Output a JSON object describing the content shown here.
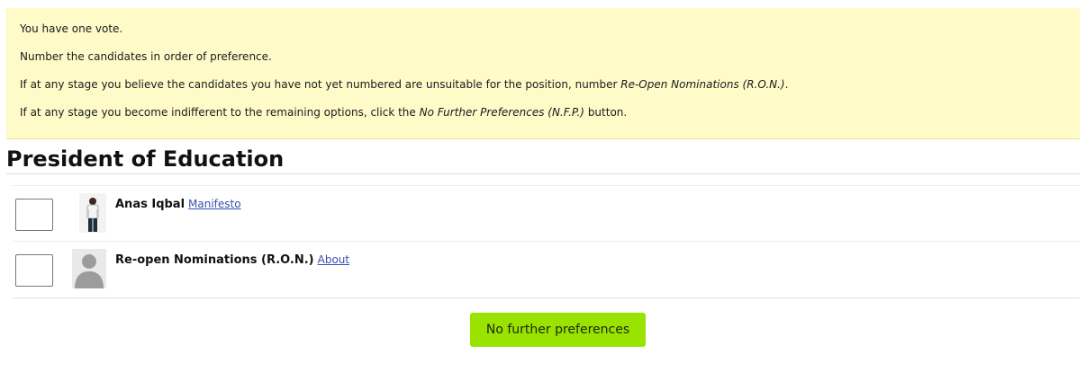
{
  "instructions": {
    "line1": "You have one vote.",
    "line2": "Number the candidates in order of preference.",
    "line3_prefix": "If at any stage you believe the candidates you have not yet numbered are unsuitable for the position, number ",
    "line3_em": "Re-Open Nominations (R.O.N.)",
    "line3_suffix": ".",
    "line4_prefix": "If at any stage you become indifferent to the remaining options, click the ",
    "line4_em": "No Further Preferences (N.F.P.)",
    "line4_suffix": " button."
  },
  "position": {
    "title": "President of Education"
  },
  "candidates": [
    {
      "name": "Anas Iqbal",
      "link": "Manifesto",
      "icon": "candidate-photo"
    },
    {
      "name": "Re-open Nominations (R.O.N.)",
      "link": "About",
      "icon": "placeholder-avatar"
    }
  ],
  "nfp_button": {
    "label": "No further preferences"
  },
  "colors": {
    "notice_bg": "#fefbc9",
    "button_bg": "#9ae200",
    "link": "#3a4fb0"
  }
}
